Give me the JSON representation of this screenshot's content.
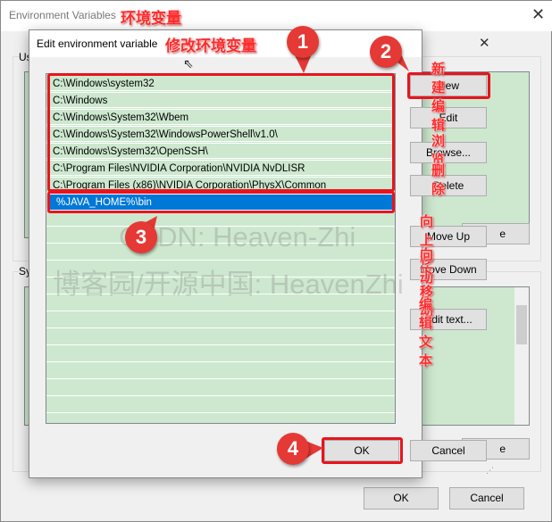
{
  "outer_window": {
    "title": "Environment Variables",
    "annotation": "环境变量",
    "user_group_label": "Us",
    "system_group_label": "Sy",
    "partial_button_1": "e",
    "partial_button_2": "e",
    "ok": "OK",
    "cancel": "Cancel"
  },
  "dialog": {
    "title": "Edit environment variable",
    "annotation": "修改环境变量",
    "entries": [
      "C:\\Windows\\system32",
      "C:\\Windows",
      "C:\\Windows\\System32\\Wbem",
      "C:\\Windows\\System32\\WindowsPowerShell\\v1.0\\",
      "C:\\Windows\\System32\\OpenSSH\\",
      "C:\\Program Files\\NVIDIA Corporation\\NVIDIA NvDLISR",
      "C:\\Program Files (x86)\\NVIDIA Corporation\\PhysX\\Common",
      "%JAVA_HOME%\\bin"
    ],
    "selected_entry": "%JAVA_HOME%\\bin",
    "buttons": {
      "new": "New",
      "edit": "Edit",
      "browse": "Browse...",
      "delete": "Delete",
      "move_up": "Move Up",
      "move_down": "Move Down",
      "edit_text": "Edit text...",
      "ok": "OK",
      "cancel": "Cancel"
    },
    "button_annotations": {
      "new": "新建",
      "edit": "编辑",
      "browse": "浏览",
      "delete": "删除",
      "move_up": "向上移动",
      "move_down": "向下移动",
      "edit_text": "编辑文本"
    }
  },
  "markers": [
    "1",
    "2",
    "3",
    "4"
  ],
  "watermark": {
    "line1": "CSDN: Heaven-Zhi",
    "line2": "博客园/开源中国: HeavenZhi"
  },
  "colors": {
    "list_bg": "#cde8cf",
    "selection": "#0078d7",
    "highlight": "#e8141d"
  }
}
